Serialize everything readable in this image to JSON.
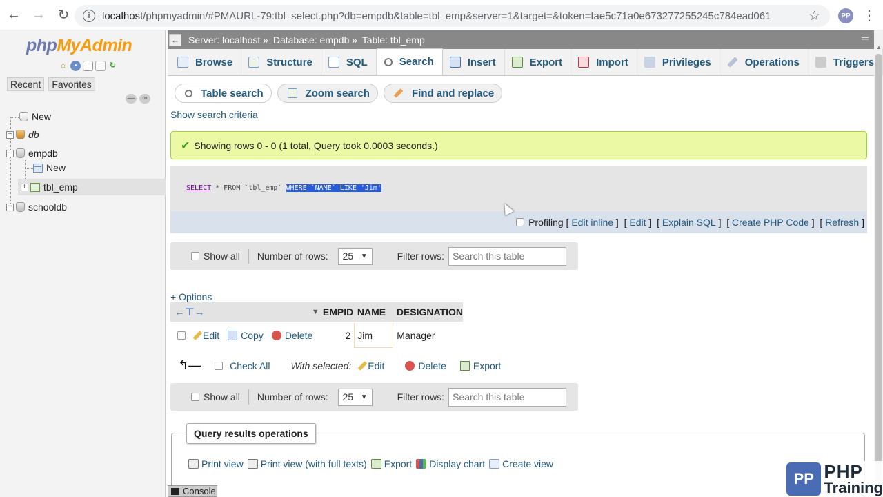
{
  "browser": {
    "url_host": "localhost",
    "url_rest": "/phpmyadmin/#PMAURL-79:tbl_select.php?db=empdb&table=tbl_emp&server=1&target=&token=fae5c71a0e673277255245c784ead061"
  },
  "sidebar": {
    "logo_php": "php",
    "logo_myadmin": "MyAdmin",
    "recent": "Recent",
    "favorites": "Favorites",
    "tree": [
      "New",
      "db",
      "empdb",
      "New",
      "tbl_emp",
      "schooldb"
    ]
  },
  "breadcrumb": {
    "server": "Server: localhost »",
    "database": "Database: empdb »",
    "table": "Table: tbl_emp"
  },
  "tabs": [
    "Browse",
    "Structure",
    "SQL",
    "Search",
    "Insert",
    "Export",
    "Import",
    "Privileges",
    "Operations",
    "Triggers"
  ],
  "subtabs": [
    "Table search",
    "Zoom search",
    "Find and replace"
  ],
  "show_search_criteria": "Show search criteria",
  "success_message": "Showing rows 0 - 0 (1 total, Query took 0.0003 seconds.)",
  "sql": {
    "select": "SELECT",
    "middle": " * FROM `tbl_emp` ",
    "highlight": "WHERE `NAME` LIKE 'Jim'"
  },
  "sql_links": {
    "profiling": "Profiling",
    "edit_inline": "Edit inline",
    "edit": "Edit",
    "explain": "Explain SQL",
    "create_php": "Create PHP Code",
    "refresh": "Refresh"
  },
  "navigation": {
    "show_all": "Show all",
    "number_of_rows_label": "Number of rows:",
    "number_of_rows_value": "25",
    "filter_rows_label": "Filter rows:",
    "filter_placeholder": "Search this table"
  },
  "options_link": "+ Options",
  "table": {
    "columns": [
      "EMPID",
      "NAME",
      "DESIGNATION"
    ],
    "row_actions": [
      "Edit",
      "Copy",
      "Delete"
    ],
    "rows": [
      {
        "empid": "2",
        "name": "Jim",
        "designation": "Manager"
      }
    ]
  },
  "bulk": {
    "check_all": "Check All",
    "with_selected": "With selected:",
    "edit": "Edit",
    "delete": "Delete",
    "export": "Export"
  },
  "query_ops": {
    "legend": "Query results operations",
    "items": [
      "Print view",
      "Print view (with full texts)",
      "Export",
      "Display chart",
      "Create view"
    ]
  },
  "console": "Console",
  "watermark": {
    "line1": "PHP",
    "line2": "Training"
  }
}
